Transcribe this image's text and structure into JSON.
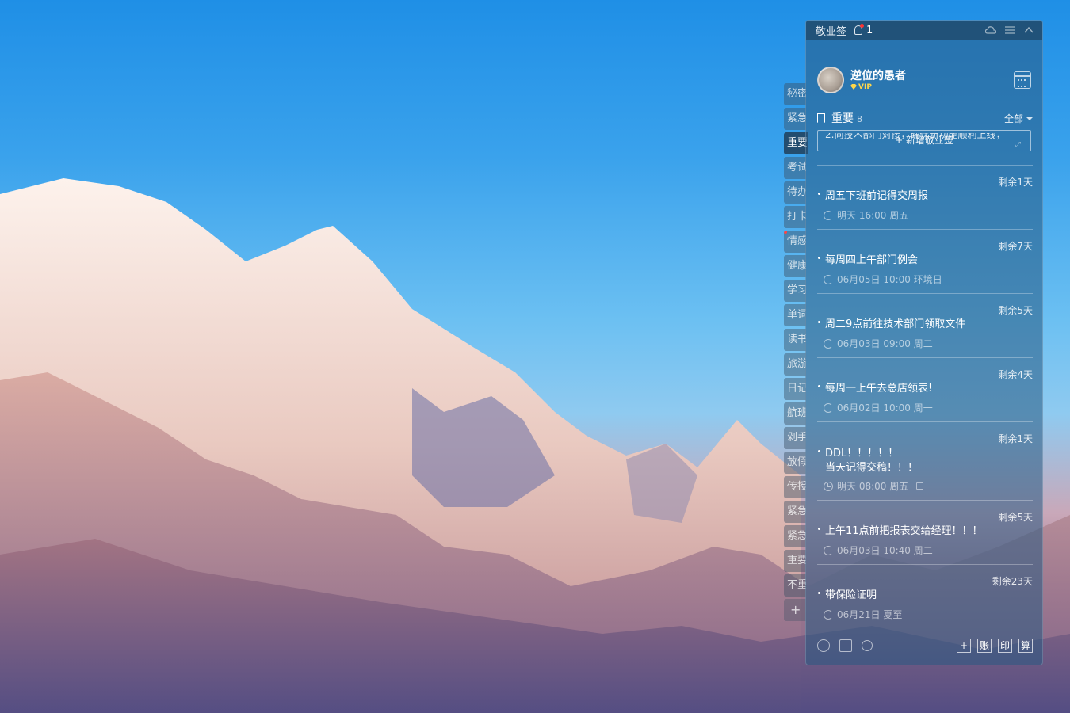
{
  "app": {
    "title": "敬业签",
    "notification_count": "1"
  },
  "user": {
    "name": "逆位的愚者",
    "badge": "VIP"
  },
  "side_tabs": [
    {
      "label": "秘密"
    },
    {
      "label": "紧急"
    },
    {
      "label": "重要"
    },
    {
      "label": "考试"
    },
    {
      "label": "待办"
    },
    {
      "label": "打卡"
    },
    {
      "label": "情感"
    },
    {
      "label": "健康"
    },
    {
      "label": "学习"
    },
    {
      "label": "单词"
    },
    {
      "label": "读书"
    },
    {
      "label": "旅游"
    },
    {
      "label": "日记"
    },
    {
      "label": "航班"
    },
    {
      "label": "剁手"
    },
    {
      "label": "放假"
    },
    {
      "label": "传授"
    },
    {
      "label": "紧急"
    },
    {
      "label": "紧急"
    },
    {
      "label": "重要"
    },
    {
      "label": "不重"
    },
    {
      "label": "+"
    }
  ],
  "section": {
    "title": "重要",
    "count": "8",
    "filter": "全部"
  },
  "new_button": {
    "label": "+ 新增敬业签"
  },
  "clipped_text": "2.向技术部门对接，确保新功能顺利上线；",
  "notes": [
    {
      "remain": "剩余1天",
      "text": "周五下班前记得交周报",
      "meta": "明天 16:00 周五"
    },
    {
      "remain": "剩余7天",
      "text": "每周四上午部门例会",
      "meta": "06月05日 10:00 环境日"
    },
    {
      "remain": "剩余5天",
      "text": "周二9点前往技术部门领取文件",
      "meta": "06月03日 09:00 周二"
    },
    {
      "remain": "剩余4天",
      "text": "每周一上午去总店领表!",
      "meta": "06月02日 10:00 周一"
    },
    {
      "remain": "剩余1天",
      "text": "DDL！！！！！",
      "text2": "当天记得交稿！！！",
      "meta": "明天 08:00 周五"
    },
    {
      "remain": "剩余5天",
      "text": "上午11点前把报表交给经理！！！",
      "meta": "06月03日 10:40 周二"
    },
    {
      "remain": "剩余23天",
      "text": "带保险证明",
      "meta": "06月21日 夏至"
    }
  ],
  "footer": {
    "btn_add": "+",
    "btn_account": "账",
    "btn_print": "印",
    "btn_calc": "算"
  }
}
